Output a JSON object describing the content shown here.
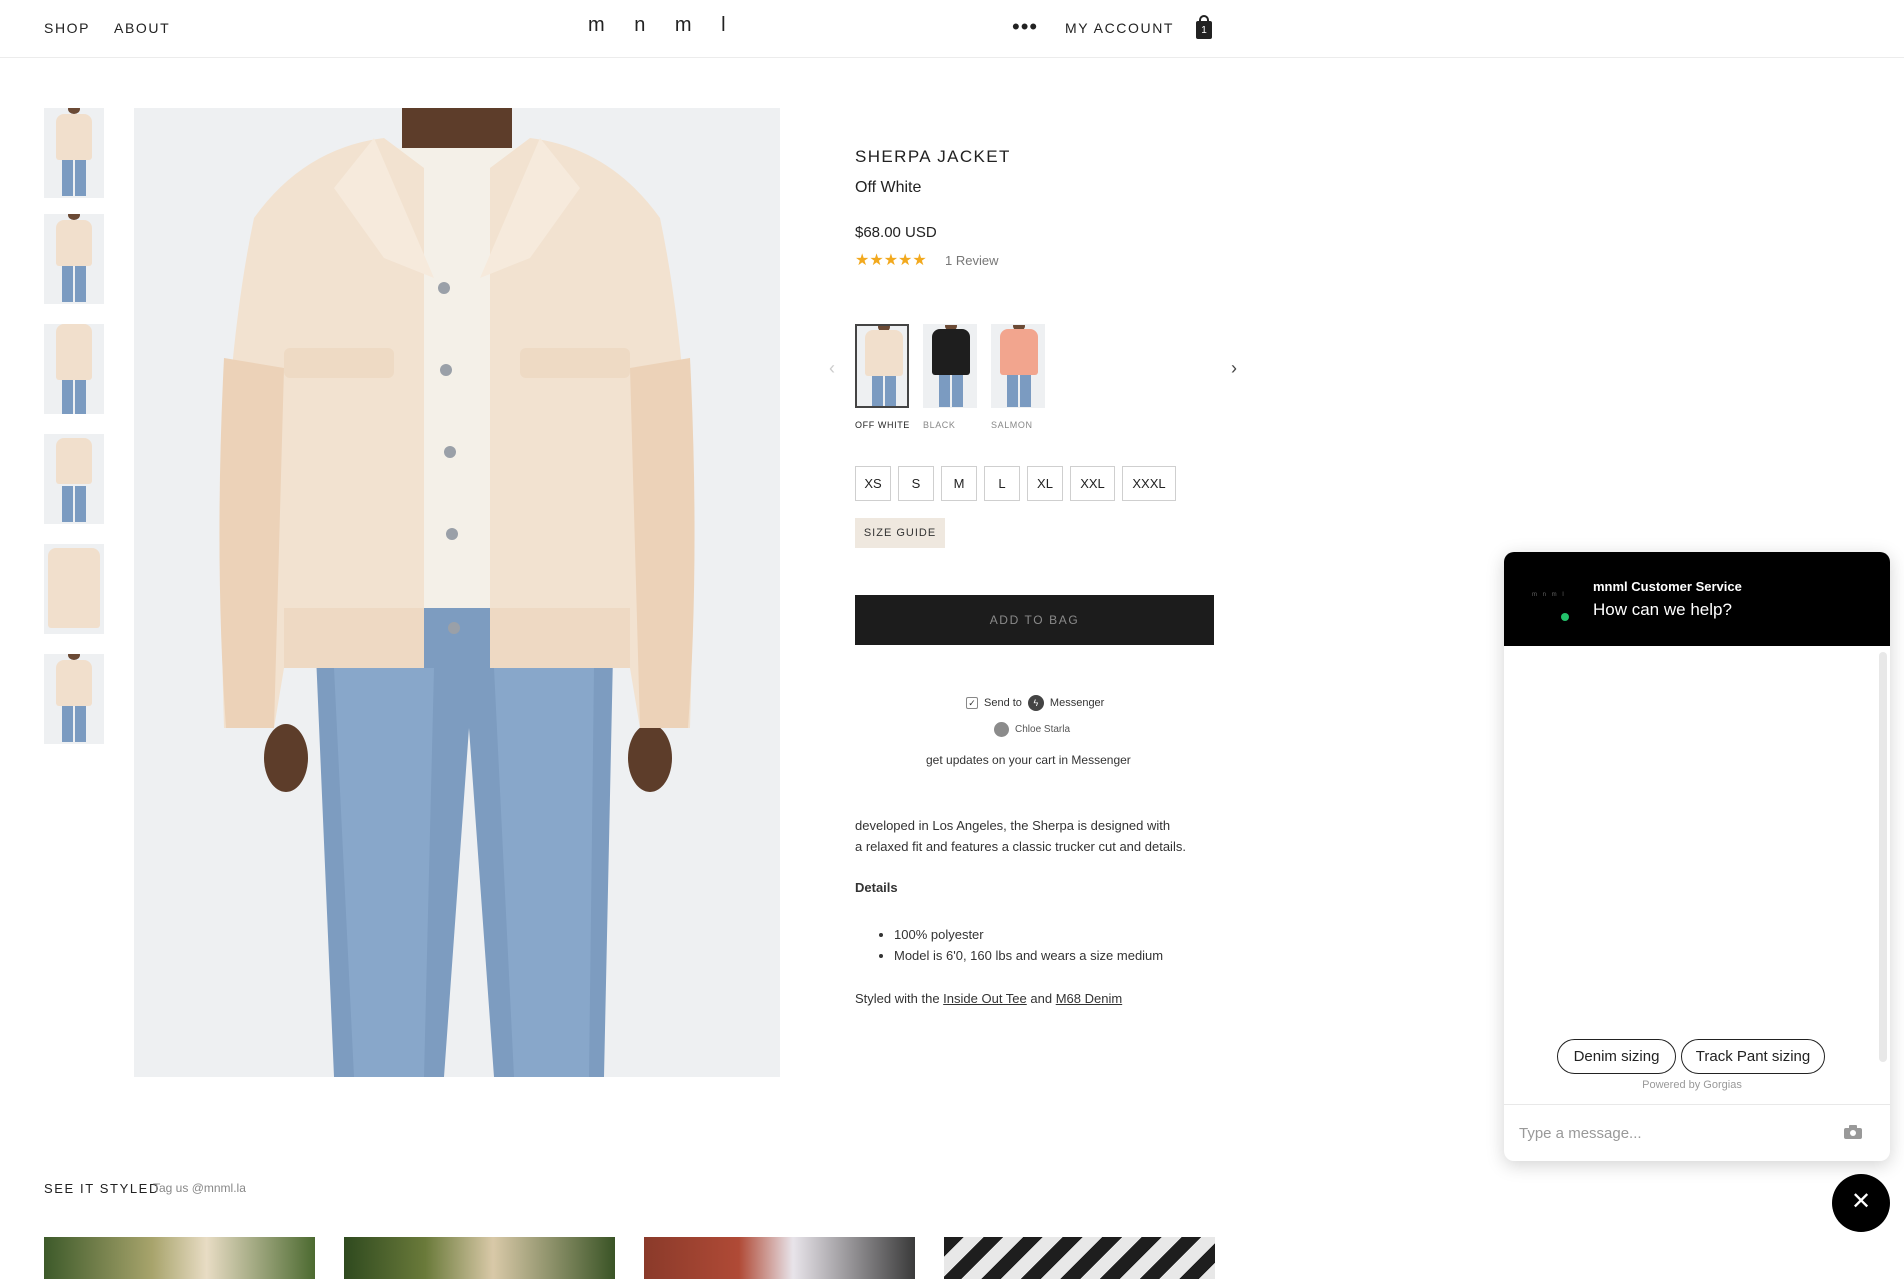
{
  "header": {
    "nav": [
      "SHOP",
      "ABOUT"
    ],
    "logo": "m n m l",
    "more_icon": "more-dots-icon",
    "account_label": "MY ACCOUNT",
    "bag_icon": "shopping-bag-icon",
    "bag_count": "1"
  },
  "product": {
    "title": "SHERPA JACKET",
    "color": "Off White",
    "price": "$68.00 USD",
    "rating": 5,
    "stars": "★★★★★",
    "reviews": "1 Review",
    "swatches": [
      {
        "label": "OFF WHITE",
        "color": "#f1dfcc",
        "selected": true
      },
      {
        "label": "BLACK",
        "color": "#1e1e1e",
        "selected": false
      },
      {
        "label": "SALMON",
        "color": "#f2a58e",
        "selected": false
      }
    ],
    "sizes": [
      "XS",
      "S",
      "M",
      "L",
      "XL",
      "XXL",
      "XXXL"
    ],
    "size_guide": "SIZE GUIDE",
    "add_to_bag": "ADD TO BAG",
    "send_to": "Send to",
    "messenger": "Messenger",
    "messenger_user": "Chloe Starla",
    "messenger_note": "get updates on your cart in Messenger",
    "description_line1": "developed in Los Angeles, the Sherpa is designed with",
    "description_line2": "a relaxed fit and features a classic trucker cut and details.",
    "details_heading": "Details",
    "details": [
      "100% polyester",
      "Model is 6'0, 160 lbs and wears a size medium"
    ],
    "styled_prefix": "Styled with the",
    "styled_link1": "Inside Out Tee",
    "styled_and": "and",
    "styled_link2": "M68 Denim"
  },
  "styled_section": {
    "title": "SEE IT STYLED",
    "tag": "Tag us @mnml.la"
  },
  "chat": {
    "logo": "m n m l",
    "name": "mnml Customer Service",
    "subtitle": "How can we help?",
    "chips": [
      "Denim sizing",
      "Track Pant sizing"
    ],
    "powered": "Powered by Gorgias",
    "placeholder": "Type a message...",
    "close_icon": "close-icon",
    "online_color": "#23c16b"
  },
  "colors": {
    "accent_star": "#f2a91e",
    "button_dark": "#1c1c1c",
    "size_guide_bg": "#efe8df"
  }
}
